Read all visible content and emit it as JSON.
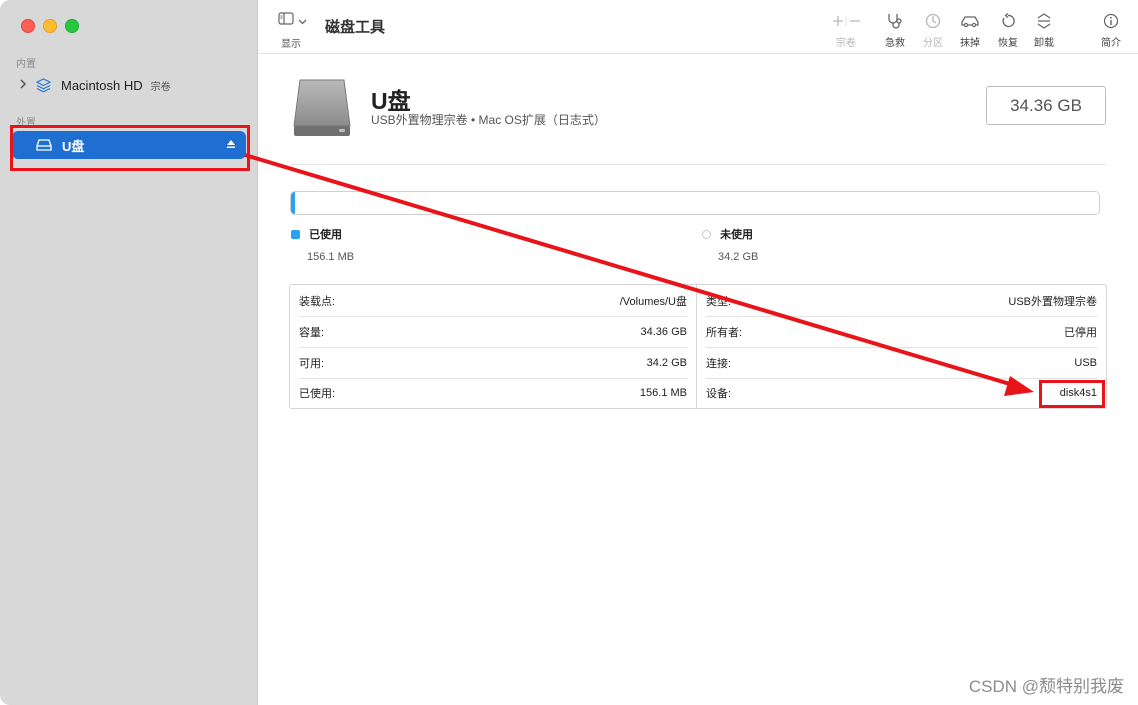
{
  "app": {
    "title": "磁盘工具"
  },
  "toolbar": {
    "show_label": "显示",
    "buttons": [
      {
        "id": "volume",
        "label": "宗卷",
        "icon": "plus-minus-icon",
        "enabled": false
      },
      {
        "id": "firstaid",
        "label": "急救",
        "icon": "stethoscope-icon",
        "enabled": true
      },
      {
        "id": "partition",
        "label": "分区",
        "icon": "pie-clock-icon",
        "enabled": false
      },
      {
        "id": "erase",
        "label": "抹掉",
        "icon": "car-drive-icon",
        "enabled": true
      },
      {
        "id": "restore",
        "label": "恢复",
        "icon": "restore-arrow-icon",
        "enabled": true
      },
      {
        "id": "unmount",
        "label": "卸载",
        "icon": "unmount-icon",
        "enabled": true
      },
      {
        "id": "info",
        "label": "简介",
        "icon": "info-icon",
        "enabled": true
      }
    ]
  },
  "sidebar": {
    "internal_label": "内置",
    "external_label": "外置",
    "internal_items": [
      {
        "name": "Macintosh HD",
        "sub": "宗卷"
      }
    ],
    "external_items": [
      {
        "name": "U盘"
      }
    ]
  },
  "disk": {
    "name": "U盘",
    "description": "USB外置物理宗卷 • Mac OS扩展（日志式）",
    "capacity": "34.36 GB",
    "used_fraction": 0.0045
  },
  "usage": {
    "used_label": "已使用",
    "used_value": "156.1 MB",
    "used_color": "#2ba1f3",
    "free_label": "未使用",
    "free_value": "34.2 GB"
  },
  "info": {
    "left": [
      {
        "label": "装载点:",
        "value": "/Volumes/U盘"
      },
      {
        "label": "容量:",
        "value": "34.36 GB"
      },
      {
        "label": "可用:",
        "value": "34.2 GB"
      },
      {
        "label": "已使用:",
        "value": "156.1 MB"
      }
    ],
    "right": [
      {
        "label": "类型:",
        "value": "USB外置物理宗卷"
      },
      {
        "label": "所有者:",
        "value": "已停用"
      },
      {
        "label": "连接:",
        "value": "USB"
      },
      {
        "label": "设备:",
        "value": "disk4s1"
      }
    ]
  },
  "watermark": "CSDN @颓特别我废",
  "annotation_color": "#e8141a"
}
